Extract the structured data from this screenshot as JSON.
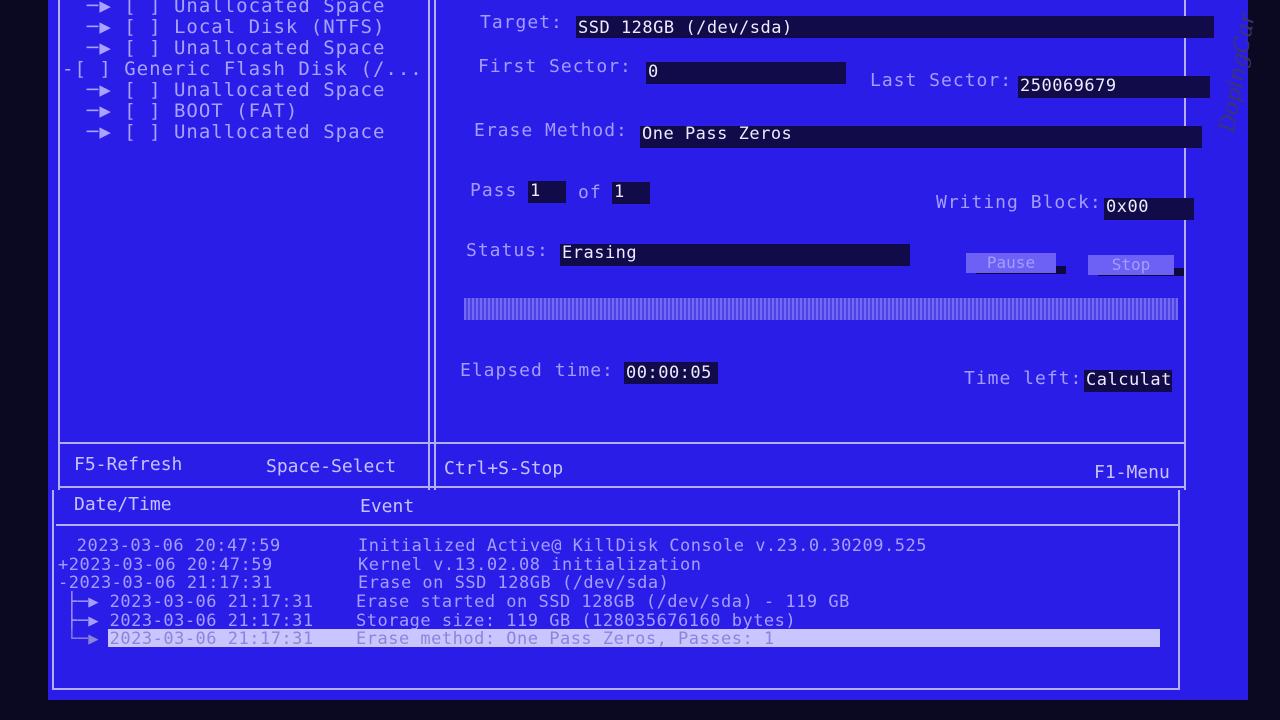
{
  "tree": {
    "items": [
      {
        "prefix": "  ─▶ [ ] ",
        "label": "Unallocated Space"
      },
      {
        "prefix": "  ─▶ [ ] ",
        "label": "Local Disk (NTFS)"
      },
      {
        "prefix": "  ─▶ [ ] ",
        "label": "Unallocated Space"
      },
      {
        "prefix": "-[ ] ",
        "label": "Generic Flash Disk (/..."
      },
      {
        "prefix": "  ─▶ [ ] ",
        "label": "Unallocated Space"
      },
      {
        "prefix": "  ─▶ [ ] ",
        "label": "BOOT (FAT)"
      },
      {
        "prefix": "  ─▶ [ ] ",
        "label": "Unallocated Space"
      }
    ]
  },
  "erase": {
    "target_label": "Target:",
    "target_value": "SSD 128GB (/dev/sda)",
    "first_sector_label": "First Sector:",
    "first_sector_value": "0",
    "last_sector_label": "Last Sector:",
    "last_sector_value": "250069679",
    "method_label": "Erase Method:",
    "method_value": "One Pass Zeros",
    "pass_label": "Pass",
    "pass_value": "1",
    "of_label": "of",
    "of_value": "1",
    "writing_block_label": "Writing Block:",
    "writing_block_value": "0x00",
    "status_label": "Status:",
    "status_value": "Erasing",
    "pause_label": "Pause",
    "stop_label": "Stop",
    "elapsed_label": "Elapsed time:",
    "elapsed_value": "00:00:05",
    "time_left_label": "Time left:",
    "time_left_value": "Calculat"
  },
  "footer": {
    "refresh": "F5-Refresh",
    "select": "Space-Select",
    "stop": "Ctrl+S-Stop",
    "menu": "F1-Menu"
  },
  "log": {
    "col_datetime": "Date/Time",
    "col_event": "Event",
    "rows": [
      {
        "time": " 2023-03-06 20:47:59",
        "event": "Initialized Active@ KillDisk Console v.23.0.30209.525"
      },
      {
        "time": "+2023-03-06 20:47:59",
        "event": "Kernel v.13.02.08 initialization"
      },
      {
        "time": "-2023-03-06 21:17:31",
        "event": "Erase on SSD 128GB (/dev/sda)"
      },
      {
        "time": " ├─▶ 2023-03-06 21:17:31",
        "event": "Erase started on SSD 128GB (/dev/sda) - 119 GB"
      },
      {
        "time": " ├─▶ 2023-03-06 21:17:31",
        "event": "Storage size: 119 GB (128035676160 bytes)"
      },
      {
        "time": " └─▶ 2023-03-06 21:17:31",
        "event": "Erase method: One Pass Zeros, Passes: 1"
      }
    ]
  },
  "watermark": "DopingCar",
  "colors": {
    "background": "#2a1de8",
    "field": "#120b4a",
    "text": "#c7c2ff"
  }
}
